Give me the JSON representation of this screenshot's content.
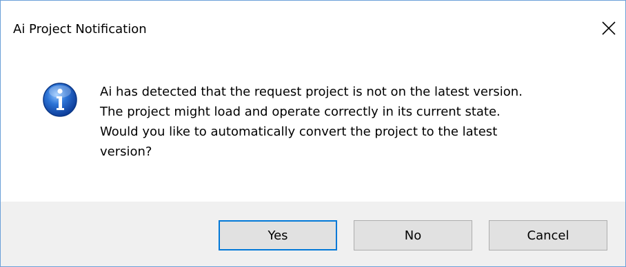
{
  "window": {
    "title": "Ai Project Notification",
    "close_glyph": "✕"
  },
  "message": {
    "icon": "info-icon",
    "lines": [
      "Ai has detected that the request project is not on the latest version.",
      "The project might load and operate correctly in its current state.",
      "Would you like to automatically convert the project to the latest",
      "version?"
    ]
  },
  "buttons": {
    "yes": "Yes",
    "no": "No",
    "cancel": "Cancel"
  },
  "colors": {
    "accent_border": "#0078d7",
    "window_border": "#6a9fd8",
    "footer_bg": "#f0f0f0",
    "button_bg": "#e1e1e1"
  }
}
